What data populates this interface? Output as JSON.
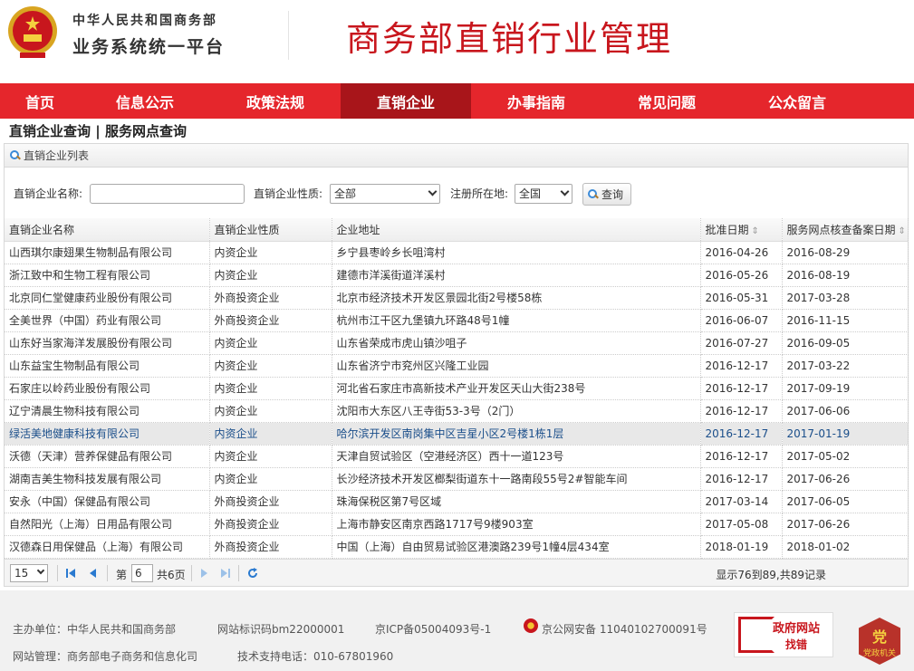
{
  "header": {
    "org_line1": "中华人民共和国商务部",
    "org_line2": "业务系统统一平台",
    "title": "商务部直销行业管理"
  },
  "nav": [
    {
      "label": "首页",
      "active": false
    },
    {
      "label": "信息公示",
      "active": false
    },
    {
      "label": "政策法规",
      "active": false
    },
    {
      "label": "直销企业",
      "active": true
    },
    {
      "label": "办事指南",
      "active": false
    },
    {
      "label": "常见问题",
      "active": false
    },
    {
      "label": "公众留言",
      "active": false
    }
  ],
  "section": {
    "tab1": "直销企业查询",
    "separator": " | ",
    "tab2": "服务网点查询"
  },
  "panel": {
    "title": "直销企业列表"
  },
  "filter": {
    "name_label": "直销企业名称:",
    "name_value": "",
    "type_label": "直销企业性质:",
    "type_value": "全部",
    "region_label": "注册所在地:",
    "region_value": "全国",
    "search_label": "查询"
  },
  "table": {
    "columns": [
      "直销企业名称",
      "直销企业性质",
      "企业地址",
      "批准日期",
      "服务网点核查备案日期"
    ],
    "rows": [
      [
        "山西琪尔康翅果生物制品有限公司",
        "内资企业",
        "乡宁县枣岭乡长咀湾村",
        "2016-04-26",
        "2016-08-29"
      ],
      [
        "浙江致中和生物工程有限公司",
        "内资企业",
        "建德市洋溪街道洋溪村",
        "2016-05-26",
        "2016-08-19"
      ],
      [
        "北京同仁堂健康药业股份有限公司",
        "外商投资企业",
        "北京市经济技术开发区景园北街2号楼58栋",
        "2016-05-31",
        "2017-03-28"
      ],
      [
        "全美世界（中国）药业有限公司",
        "外商投资企业",
        "杭州市江干区九堡镇九环路48号1幢",
        "2016-06-07",
        "2016-11-15"
      ],
      [
        "山东好当家海洋发展股份有限公司",
        "内资企业",
        "山东省荣成市虎山镇沙咀子",
        "2016-07-27",
        "2016-09-05"
      ],
      [
        "山东益宝生物制品有限公司",
        "内资企业",
        "山东省济宁市兖州区兴隆工业园",
        "2016-12-17",
        "2017-03-22"
      ],
      [
        "石家庄以岭药业股份有限公司",
        "内资企业",
        "河北省石家庄市高新技术产业开发区天山大街238号",
        "2016-12-17",
        "2017-09-19"
      ],
      [
        "辽宁清晨生物科技有限公司",
        "内资企业",
        "沈阳市大东区八王寺街53-3号（2门）",
        "2016-12-17",
        "2017-06-06"
      ],
      [
        "绿活美地健康科技有限公司",
        "内资企业",
        "哈尔滨开发区南岗集中区吉星小区2号楼1栋1层",
        "2016-12-17",
        "2017-01-19"
      ],
      [
        "沃德（天津）营养保健品有限公司",
        "内资企业",
        "天津自贸试验区（空港经济区）西十一道123号",
        "2016-12-17",
        "2017-05-02"
      ],
      [
        "湖南吉美生物科技发展有限公司",
        "内资企业",
        "长沙经济技术开发区榔梨街道东十一路南段55号2#智能车间",
        "2016-12-17",
        "2017-06-26"
      ],
      [
        "安永（中国）保健品有限公司",
        "外商投资企业",
        "珠海保税区第7号区域",
        "2017-03-14",
        "2017-06-05"
      ],
      [
        "自然阳光（上海）日用品有限公司",
        "外商投资企业",
        "上海市静安区南京西路1717号9楼903室",
        "2017-05-08",
        "2017-06-26"
      ],
      [
        "汉德森日用保健品（上海）有限公司",
        "外商投资企业",
        "中国（上海）自由贸易试验区港澳路239号1幢4层434室",
        "2018-01-19",
        "2018-01-02"
      ]
    ],
    "highlighted_row": 8
  },
  "pager": {
    "page_size": "15",
    "page_prefix": "第",
    "current_page": "6",
    "page_suffix": "共6页",
    "info": "显示76到89,共89记录"
  },
  "footer": {
    "sponsor": "主办单位：中华人民共和国商务部",
    "site_id": "网站标识码bm22000001",
    "icp": "京ICP备05004093号-1",
    "police": "京公网安备 11040102700091号",
    "manager": "网站管理：商务部电子商务和信息化司",
    "support": "技术支持电话：010-67801960",
    "gov_badge_line1": "政府网站",
    "gov_badge_line2": "找错",
    "dangzheng_main": "党",
    "dangzheng_sub": "党政机关"
  },
  "colors": {
    "brand_red": "#e5262c",
    "active_nav": "#a8151a",
    "title_red": "#c8161d"
  }
}
